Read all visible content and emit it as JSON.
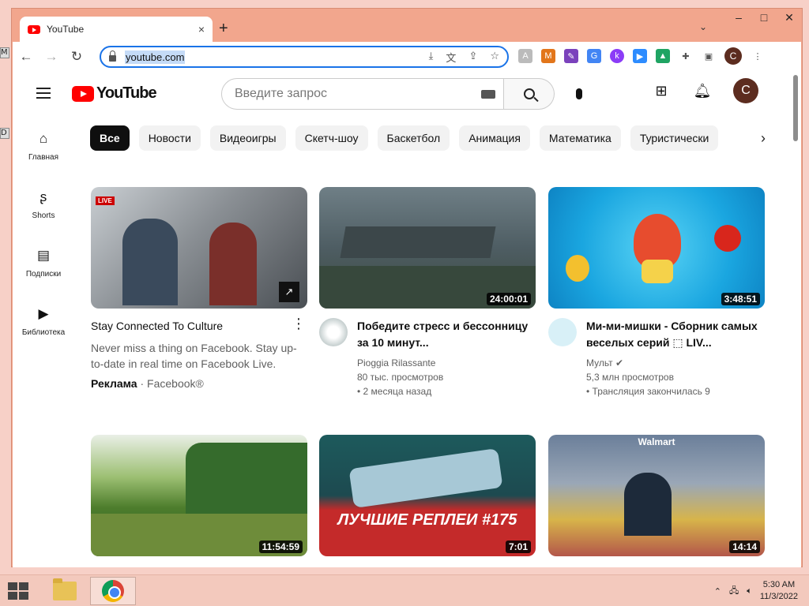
{
  "taskbar": {
    "time": "5:30 AM",
    "date": "11/3/2022"
  },
  "browser": {
    "tab_title": "YouTube",
    "tab_close": "×",
    "new_tab": "+",
    "url": "youtube.com",
    "profile_letter": "C"
  },
  "youtube": {
    "logo_text": "YouTube",
    "search_placeholder": "Введите запрос",
    "avatar_letter": "C",
    "sidebar": [
      {
        "label": "Главная"
      },
      {
        "label": "Shorts"
      },
      {
        "label": "Подписки"
      },
      {
        "label": "Библиотека"
      }
    ],
    "chips": [
      "Все",
      "Новости",
      "Видеоигры",
      "Скетч-шоу",
      "Баскетбол",
      "Анимация",
      "Математика",
      "Туристически"
    ],
    "ad": {
      "title": "Stay Connected To Culture",
      "description": "Never miss a thing on Facebook. Stay up-to-date in real time on Facebook Live.",
      "label": "Реклама",
      "advertiser": "· Facebook®",
      "live": "LIVE"
    },
    "videos": [
      {
        "title": "Победите стресс и бессонницу за 10 минут...",
        "channel": "Pioggia Rilassante",
        "views": "80 тыс. просмотров",
        "age": "• 2 месяца назад",
        "duration": "24:00:01"
      },
      {
        "title": "Ми-ми-мишки - Сборник самых веселых серий ⬚ LIV...",
        "channel": "Мульт ✔",
        "views": "5,3 млн просмотров",
        "age": "• Трансляция закончилась 9",
        "duration": "3:48:51"
      },
      {
        "duration": "11:54:59"
      },
      {
        "duration": "7:01",
        "overlay_text": "ЛУЧШИЕ РЕПЛЕИ #175"
      },
      {
        "duration": "14:14",
        "overlay_text": "Walmart"
      }
    ]
  }
}
